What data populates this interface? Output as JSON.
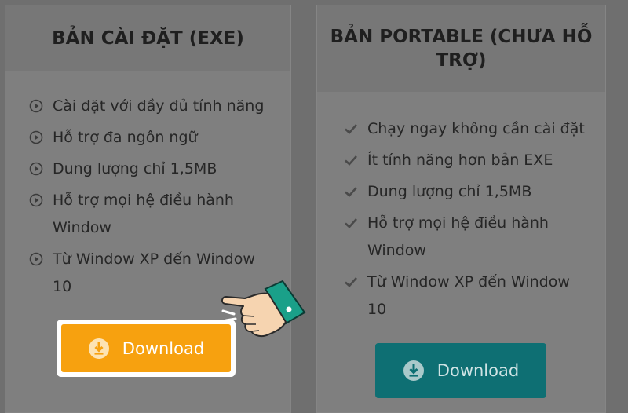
{
  "cards": {
    "exe": {
      "title": "BẢN CÀI ĐẶT (EXE)",
      "features": [
        "Cài đặt với đầy đủ tính năng",
        "Hỗ trợ đa ngôn ngữ",
        "Dung lượng chỉ 1,5MB",
        "Hỗ trợ mọi hệ điều hành Window",
        "Từ Window XP đến Window 10"
      ],
      "button_label": "Download",
      "button_color": "#f7a10f"
    },
    "portable": {
      "title": "BẢN PORTABLE (CHƯA HỖ TRỢ)",
      "features": [
        "Chạy ngay không cần cài đặt",
        "Ít tính năng hơn bản EXE",
        "Dung lượng chỉ 1,5MB",
        "Hỗ trợ mọi hệ điều hành Window",
        "Từ Window XP đến Window 10"
      ],
      "button_label": "Download",
      "button_color": "#0e6f73"
    }
  },
  "icons": {
    "exe_bullet": "play-circle-icon",
    "portable_bullet": "check-icon",
    "download": "download-icon",
    "pointer": "hand-pointer-icon"
  }
}
